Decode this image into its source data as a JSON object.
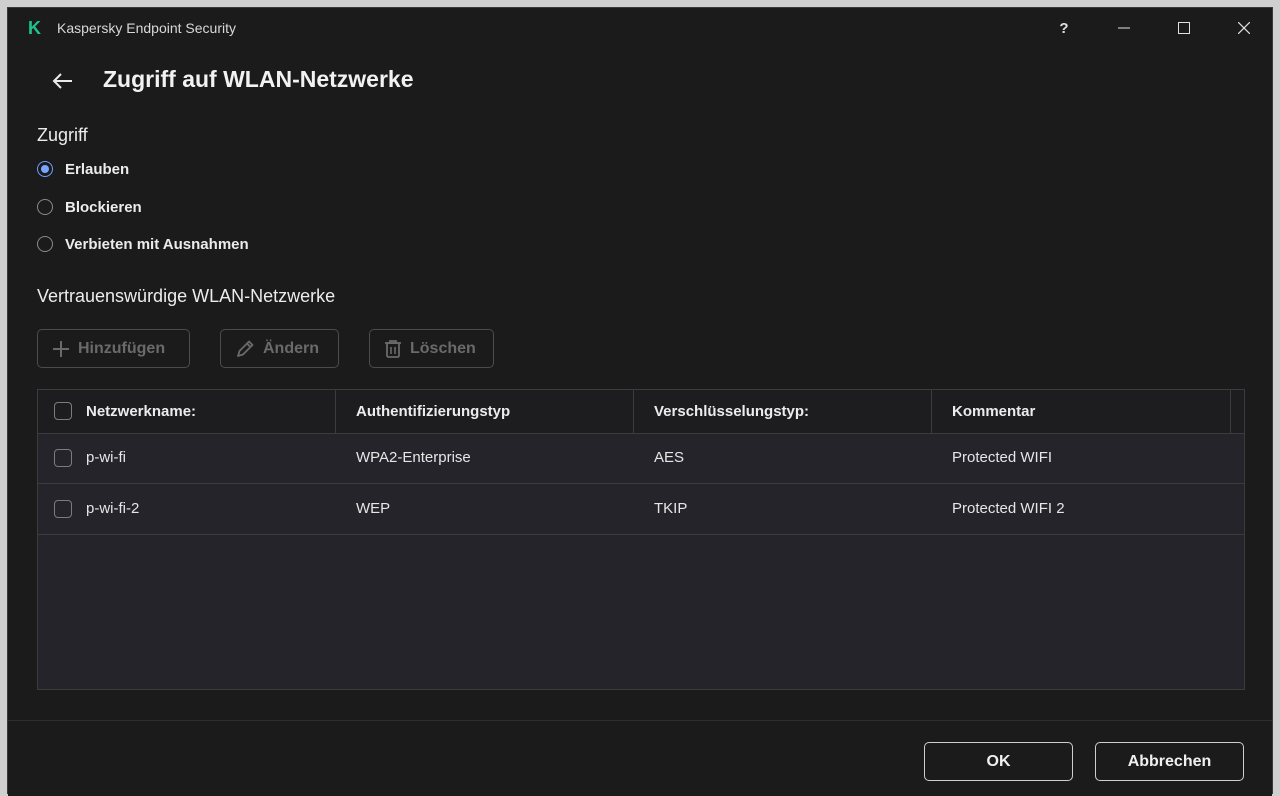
{
  "window": {
    "title": "Kaspersky Endpoint Security",
    "logo_letter": "K",
    "help_label": "?",
    "accent": "#1fc28c"
  },
  "page": {
    "title": "Zugriff auf WLAN-Netzwerke"
  },
  "access": {
    "label": "Zugriff",
    "options": [
      {
        "label": "Erlauben",
        "checked": true
      },
      {
        "label": "Blockieren",
        "checked": false
      },
      {
        "label": "Verbieten mit Ausnahmen",
        "checked": false
      }
    ]
  },
  "trusted": {
    "label": "Vertrauenswürdige WLAN-Netzwerke",
    "toolbar": {
      "add": "Hinzufügen",
      "edit": "Ändern",
      "delete": "Löschen"
    },
    "columns": [
      "Netzwerkname:",
      "Authentifizierungstyp",
      "Verschlüsselungstyp:",
      "Kommentar"
    ],
    "rows": [
      {
        "name": "p-wi-fi",
        "auth": "WPA2-Enterprise",
        "enc": "AES",
        "comment": "Protected WIFI"
      },
      {
        "name": "p-wi-fi-2",
        "auth": "WEP",
        "enc": "TKIP",
        "comment": "Protected WIFI 2"
      }
    ]
  },
  "footer": {
    "ok": "OK",
    "cancel": "Abbrechen"
  }
}
